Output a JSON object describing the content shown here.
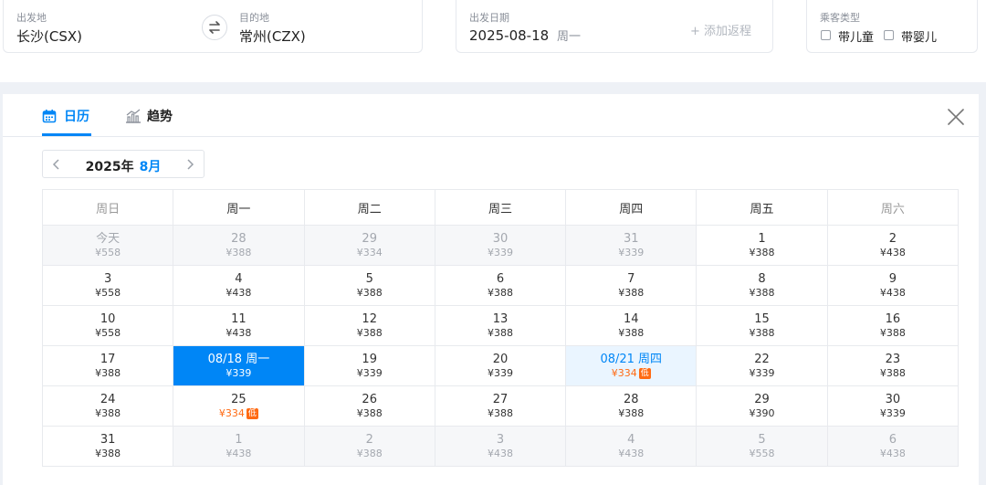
{
  "search": {
    "from": {
      "label": "出发地",
      "value": "长沙(CSX)"
    },
    "to": {
      "label": "目的地",
      "value": "常州(CZX)"
    },
    "depart": {
      "label": "出发日期",
      "date": "2025-08-18",
      "weekday": "周一",
      "add_return": "+ 添加返程"
    },
    "passenger": {
      "label": "乘客类型",
      "child": "带儿童",
      "infant": "带婴儿"
    }
  },
  "tabs": {
    "calendar": "日历",
    "trend": "趋势"
  },
  "calendar": {
    "year_label": "2025年",
    "month_label": "8月",
    "low_badge": "低",
    "weekdays": [
      "周日",
      "周一",
      "周二",
      "周三",
      "周四",
      "周五",
      "周六"
    ],
    "weeks": [
      [
        {
          "day": "今天",
          "price": "¥558",
          "other": true
        },
        {
          "day": "28",
          "price": "¥388",
          "other": true
        },
        {
          "day": "29",
          "price": "¥334",
          "other": true
        },
        {
          "day": "30",
          "price": "¥339",
          "other": true
        },
        {
          "day": "31",
          "price": "¥339",
          "other": true
        },
        {
          "day": "1",
          "price": "¥388"
        },
        {
          "day": "2",
          "price": "¥438"
        }
      ],
      [
        {
          "day": "3",
          "price": "¥558"
        },
        {
          "day": "4",
          "price": "¥438"
        },
        {
          "day": "5",
          "price": "¥388"
        },
        {
          "day": "6",
          "price": "¥388"
        },
        {
          "day": "7",
          "price": "¥388"
        },
        {
          "day": "8",
          "price": "¥388"
        },
        {
          "day": "9",
          "price": "¥438"
        }
      ],
      [
        {
          "day": "10",
          "price": "¥558"
        },
        {
          "day": "11",
          "price": "¥438"
        },
        {
          "day": "12",
          "price": "¥388"
        },
        {
          "day": "13",
          "price": "¥388"
        },
        {
          "day": "14",
          "price": "¥388"
        },
        {
          "day": "15",
          "price": "¥388"
        },
        {
          "day": "16",
          "price": "¥388"
        }
      ],
      [
        {
          "day": "17",
          "price": "¥388"
        },
        {
          "day": "08/18 周一",
          "price": "¥339",
          "selected": true
        },
        {
          "day": "19",
          "price": "¥339"
        },
        {
          "day": "20",
          "price": "¥339"
        },
        {
          "day": "08/21 周四",
          "price": "¥334",
          "low": true,
          "highlight": true
        },
        {
          "day": "22",
          "price": "¥339"
        },
        {
          "day": "23",
          "price": "¥388"
        }
      ],
      [
        {
          "day": "24",
          "price": "¥388"
        },
        {
          "day": "25",
          "price": "¥334",
          "low": true
        },
        {
          "day": "26",
          "price": "¥388"
        },
        {
          "day": "27",
          "price": "¥388"
        },
        {
          "day": "28",
          "price": "¥388"
        },
        {
          "day": "29",
          "price": "¥390"
        },
        {
          "day": "30",
          "price": "¥339"
        }
      ],
      [
        {
          "day": "31",
          "price": "¥388"
        },
        {
          "day": "1",
          "price": "¥438",
          "other": true
        },
        {
          "day": "2",
          "price": "¥388",
          "other": true
        },
        {
          "day": "3",
          "price": "¥438",
          "other": true
        },
        {
          "day": "4",
          "price": "¥438",
          "other": true
        },
        {
          "day": "5",
          "price": "¥558",
          "other": true
        },
        {
          "day": "6",
          "price": "¥438",
          "other": true
        }
      ]
    ]
  },
  "colors": {
    "accent": "#0086f6",
    "low_price": "#ff6a13",
    "highlight_bg": "#eaf5ff"
  }
}
